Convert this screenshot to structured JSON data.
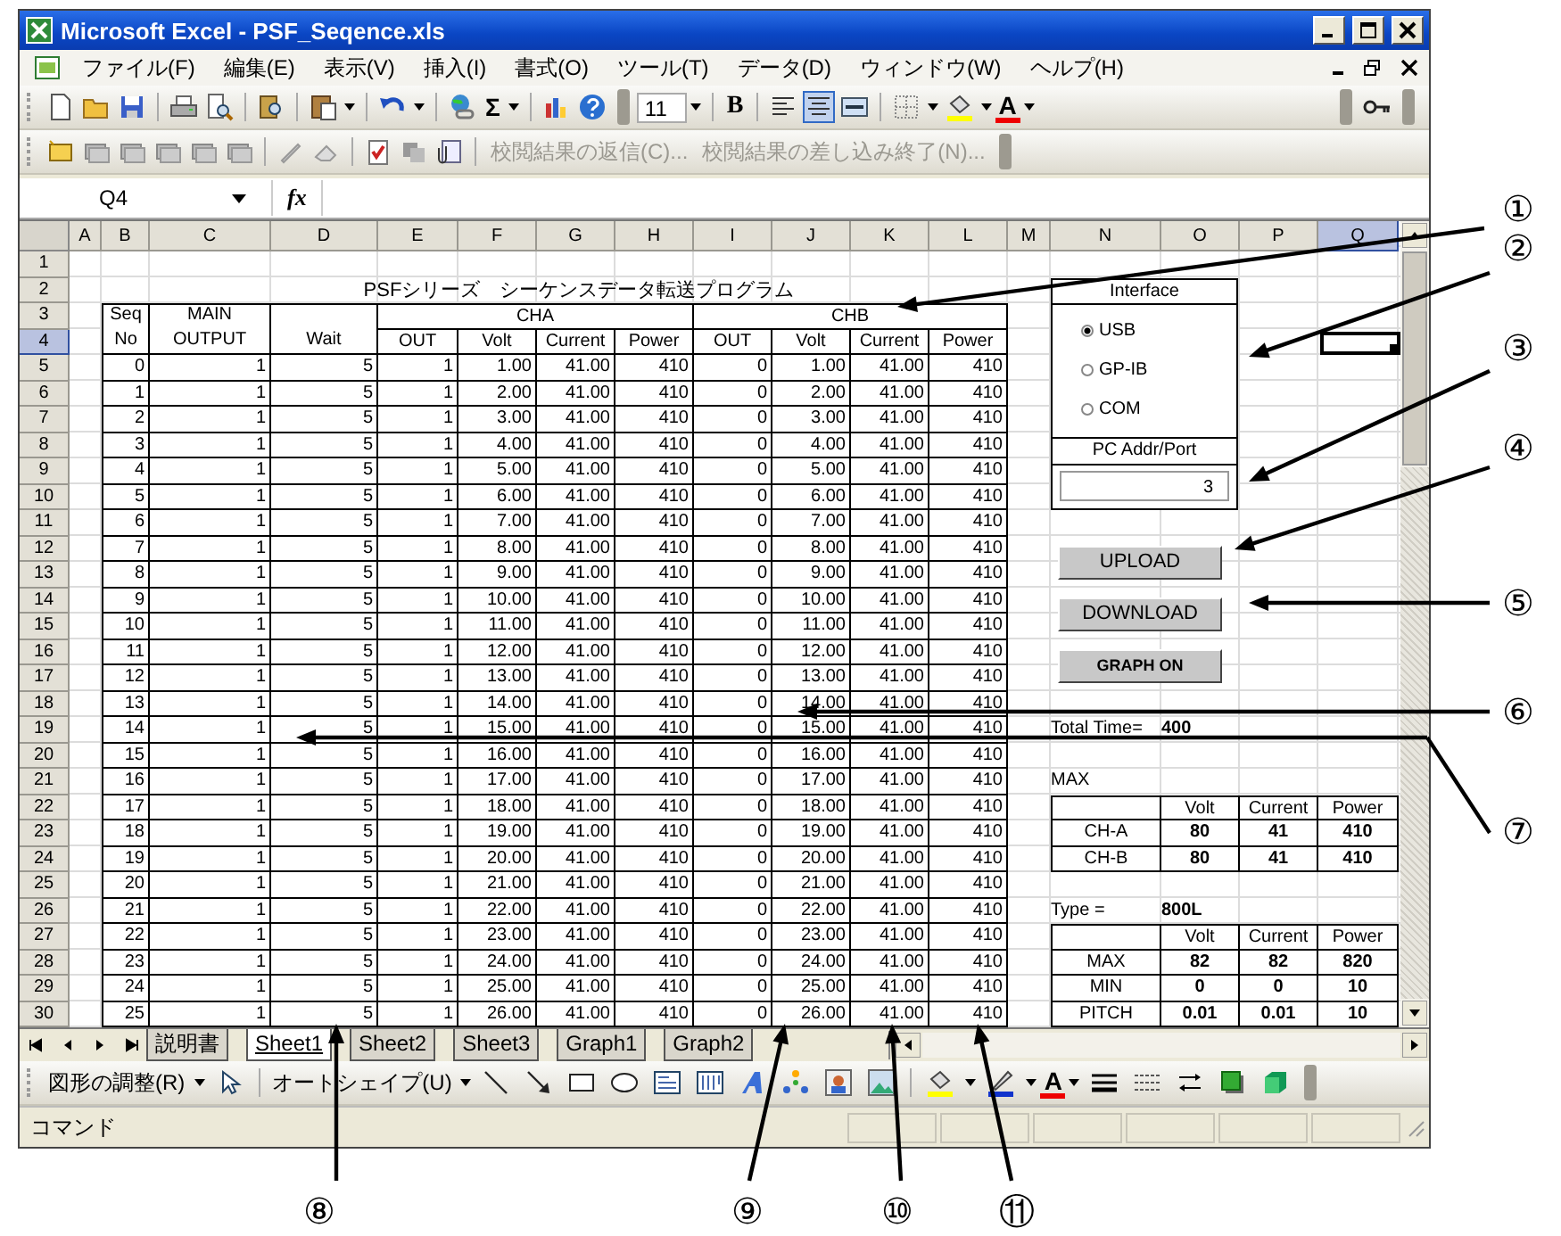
{
  "window": {
    "title": "Microsoft Excel - PSF_Seqence.xls"
  },
  "menu": [
    "ファイル(F)",
    "編集(E)",
    "表示(V)",
    "挿入(I)",
    "書式(O)",
    "ツール(T)",
    "データ(D)",
    "ウィンドウ(W)",
    "ヘルプ(H)"
  ],
  "formatting_toolbar": {
    "sum": "Σ",
    "font_size": "11",
    "bold": "B",
    "font_color": "A"
  },
  "review_toolbar": {
    "items": [
      {
        "label": "校閲結果の返信(C)...",
        "disabled": true
      },
      {
        "label": "校閲結果の差し込み終了(N)...",
        "disabled": true
      }
    ]
  },
  "formula_bar": {
    "name_box": "Q4",
    "fx": "fx"
  },
  "grid": {
    "columns": [
      {
        "label": "A",
        "selected": false
      },
      {
        "label": "B",
        "selected": false
      },
      {
        "label": "C",
        "selected": false
      },
      {
        "label": "D",
        "selected": false
      },
      {
        "label": "E",
        "selected": false
      },
      {
        "label": "F",
        "selected": false
      },
      {
        "label": "G",
        "selected": false
      },
      {
        "label": "H",
        "selected": false
      },
      {
        "label": "I",
        "selected": false
      },
      {
        "label": "J",
        "selected": false
      },
      {
        "label": "K",
        "selected": false
      },
      {
        "label": "L",
        "selected": false
      },
      {
        "label": "M",
        "selected": false
      },
      {
        "label": "N",
        "selected": false
      },
      {
        "label": "O",
        "selected": false
      },
      {
        "label": "P",
        "selected": false
      },
      {
        "label": "Q",
        "selected": true
      }
    ],
    "rows": [
      {
        "label": "1",
        "selected": false
      },
      {
        "label": "2",
        "selected": false
      },
      {
        "label": "3",
        "selected": false
      },
      {
        "label": "4",
        "selected": true
      },
      {
        "label": "5",
        "selected": false
      },
      {
        "label": "6",
        "selected": false
      },
      {
        "label": "7",
        "selected": false
      },
      {
        "label": "8",
        "selected": false
      },
      {
        "label": "9",
        "selected": false
      },
      {
        "label": "10",
        "selected": false
      },
      {
        "label": "11",
        "selected": false
      },
      {
        "label": "12",
        "selected": false
      },
      {
        "label": "13",
        "selected": false
      },
      {
        "label": "14",
        "selected": false
      },
      {
        "label": "15",
        "selected": false
      },
      {
        "label": "16",
        "selected": false
      },
      {
        "label": "17",
        "selected": false
      },
      {
        "label": "18",
        "selected": false
      },
      {
        "label": "19",
        "selected": false
      },
      {
        "label": "20",
        "selected": false
      },
      {
        "label": "21",
        "selected": false
      },
      {
        "label": "22",
        "selected": false
      },
      {
        "label": "23",
        "selected": false
      },
      {
        "label": "24",
        "selected": false
      },
      {
        "label": "25",
        "selected": false
      },
      {
        "label": "26",
        "selected": false
      },
      {
        "label": "27",
        "selected": false
      },
      {
        "label": "28",
        "selected": false
      },
      {
        "label": "29",
        "selected": false
      },
      {
        "label": "30",
        "selected": false
      }
    ]
  },
  "table": {
    "title": "PSFシリーズ　シーケンスデータ転送プログラム",
    "headers": [
      {
        "lines": [
          "Seq",
          "No"
        ]
      },
      {
        "lines": [
          "MAIN",
          "OUTPUT"
        ]
      },
      {
        "lines": [
          "Wait"
        ]
      }
    ],
    "groups": [
      {
        "label": "CHA",
        "columns": [
          "OUT",
          "Volt",
          "Current",
          "Power"
        ]
      },
      {
        "label": "CHB",
        "columns": [
          "OUT",
          "Volt",
          "Current",
          "Power"
        ]
      }
    ],
    "rows": [
      [
        "0",
        "1",
        "5",
        "1",
        "1.00",
        "41.00",
        "410",
        "0",
        "1.00",
        "41.00",
        "410"
      ],
      [
        "1",
        "1",
        "5",
        "1",
        "2.00",
        "41.00",
        "410",
        "0",
        "2.00",
        "41.00",
        "410"
      ],
      [
        "2",
        "1",
        "5",
        "1",
        "3.00",
        "41.00",
        "410",
        "0",
        "3.00",
        "41.00",
        "410"
      ],
      [
        "3",
        "1",
        "5",
        "1",
        "4.00",
        "41.00",
        "410",
        "0",
        "4.00",
        "41.00",
        "410"
      ],
      [
        "4",
        "1",
        "5",
        "1",
        "5.00",
        "41.00",
        "410",
        "0",
        "5.00",
        "41.00",
        "410"
      ],
      [
        "5",
        "1",
        "5",
        "1",
        "6.00",
        "41.00",
        "410",
        "0",
        "6.00",
        "41.00",
        "410"
      ],
      [
        "6",
        "1",
        "5",
        "1",
        "7.00",
        "41.00",
        "410",
        "0",
        "7.00",
        "41.00",
        "410"
      ],
      [
        "7",
        "1",
        "5",
        "1",
        "8.00",
        "41.00",
        "410",
        "0",
        "8.00",
        "41.00",
        "410"
      ],
      [
        "8",
        "1",
        "5",
        "1",
        "9.00",
        "41.00",
        "410",
        "0",
        "9.00",
        "41.00",
        "410"
      ],
      [
        "9",
        "1",
        "5",
        "1",
        "10.00",
        "41.00",
        "410",
        "0",
        "10.00",
        "41.00",
        "410"
      ],
      [
        "10",
        "1",
        "5",
        "1",
        "11.00",
        "41.00",
        "410",
        "0",
        "11.00",
        "41.00",
        "410"
      ],
      [
        "11",
        "1",
        "5",
        "1",
        "12.00",
        "41.00",
        "410",
        "0",
        "12.00",
        "41.00",
        "410"
      ],
      [
        "12",
        "1",
        "5",
        "1",
        "13.00",
        "41.00",
        "410",
        "0",
        "13.00",
        "41.00",
        "410"
      ],
      [
        "13",
        "1",
        "5",
        "1",
        "14.00",
        "41.00",
        "410",
        "0",
        "14.00",
        "41.00",
        "410"
      ],
      [
        "14",
        "1",
        "5",
        "1",
        "15.00",
        "41.00",
        "410",
        "0",
        "15.00",
        "41.00",
        "410"
      ],
      [
        "15",
        "1",
        "5",
        "1",
        "16.00",
        "41.00",
        "410",
        "0",
        "16.00",
        "41.00",
        "410"
      ],
      [
        "16",
        "1",
        "5",
        "1",
        "17.00",
        "41.00",
        "410",
        "0",
        "17.00",
        "41.00",
        "410"
      ],
      [
        "17",
        "1",
        "5",
        "1",
        "18.00",
        "41.00",
        "410",
        "0",
        "18.00",
        "41.00",
        "410"
      ],
      [
        "18",
        "1",
        "5",
        "1",
        "19.00",
        "41.00",
        "410",
        "0",
        "19.00",
        "41.00",
        "410"
      ],
      [
        "19",
        "1",
        "5",
        "1",
        "20.00",
        "41.00",
        "410",
        "0",
        "20.00",
        "41.00",
        "410"
      ],
      [
        "20",
        "1",
        "5",
        "1",
        "21.00",
        "41.00",
        "410",
        "0",
        "21.00",
        "41.00",
        "410"
      ],
      [
        "21",
        "1",
        "5",
        "1",
        "22.00",
        "41.00",
        "410",
        "0",
        "22.00",
        "41.00",
        "410"
      ],
      [
        "22",
        "1",
        "5",
        "1",
        "23.00",
        "41.00",
        "410",
        "0",
        "23.00",
        "41.00",
        "410"
      ],
      [
        "23",
        "1",
        "5",
        "1",
        "24.00",
        "41.00",
        "410",
        "0",
        "24.00",
        "41.00",
        "410"
      ],
      [
        "24",
        "1",
        "5",
        "1",
        "25.00",
        "41.00",
        "410",
        "0",
        "25.00",
        "41.00",
        "410"
      ],
      [
        "25",
        "1",
        "5",
        "1",
        "26.00",
        "41.00",
        "410",
        "0",
        "26.00",
        "41.00",
        "410"
      ]
    ]
  },
  "panel": {
    "interface": {
      "title": "Interface",
      "options": [
        {
          "label": "USB",
          "selected": true
        },
        {
          "label": "GP-IB",
          "selected": false
        },
        {
          "label": "COM",
          "selected": false
        }
      ],
      "port_label": "PC Addr/Port",
      "port_value": "3"
    },
    "buttons": [
      "UPLOAD",
      "DOWNLOAD",
      "GRAPH ON"
    ],
    "total_time": {
      "label": "Total Time=",
      "value": "400"
    },
    "max": {
      "title": "MAX",
      "columns": [
        "Volt",
        "Current",
        "Power"
      ],
      "rows": [
        {
          "label": "CH-A",
          "values": [
            "80",
            "41",
            "410"
          ]
        },
        {
          "label": "CH-B",
          "values": [
            "80",
            "41",
            "410"
          ]
        }
      ]
    },
    "type": {
      "label": "Type =",
      "value": "800L",
      "columns": [
        "Volt",
        "Current",
        "Power"
      ],
      "rows": [
        {
          "label": "MAX",
          "values": [
            "82",
            "82",
            "820"
          ]
        },
        {
          "label": "MIN",
          "values": [
            "0",
            "0",
            "10"
          ]
        },
        {
          "label": "PITCH",
          "values": [
            "0.01",
            "0.01",
            "10"
          ]
        }
      ]
    }
  },
  "sheet_tabs": [
    {
      "label": "説明書",
      "selected": false
    },
    {
      "label": "Sheet1",
      "selected": true
    },
    {
      "label": "Sheet2",
      "selected": false
    },
    {
      "label": "Sheet3",
      "selected": false
    },
    {
      "label": "Graph1",
      "selected": false
    },
    {
      "label": "Graph2",
      "selected": false
    }
  ],
  "drawing_toolbar": {
    "draw_menu": "図形の調整(R)",
    "autoshapes": "オートシェイプ(U)",
    "font_color": "A"
  },
  "status_bar": {
    "text": "コマンド"
  },
  "callouts": [
    {
      "label": "①"
    },
    {
      "label": "②"
    },
    {
      "label": "③"
    },
    {
      "label": "④"
    },
    {
      "label": "⑤"
    },
    {
      "label": "⑥"
    },
    {
      "label": "⑦"
    },
    {
      "label": "⑧"
    },
    {
      "label": "⑨"
    },
    {
      "label": "⑩"
    },
    {
      "label": "⑪"
    }
  ]
}
